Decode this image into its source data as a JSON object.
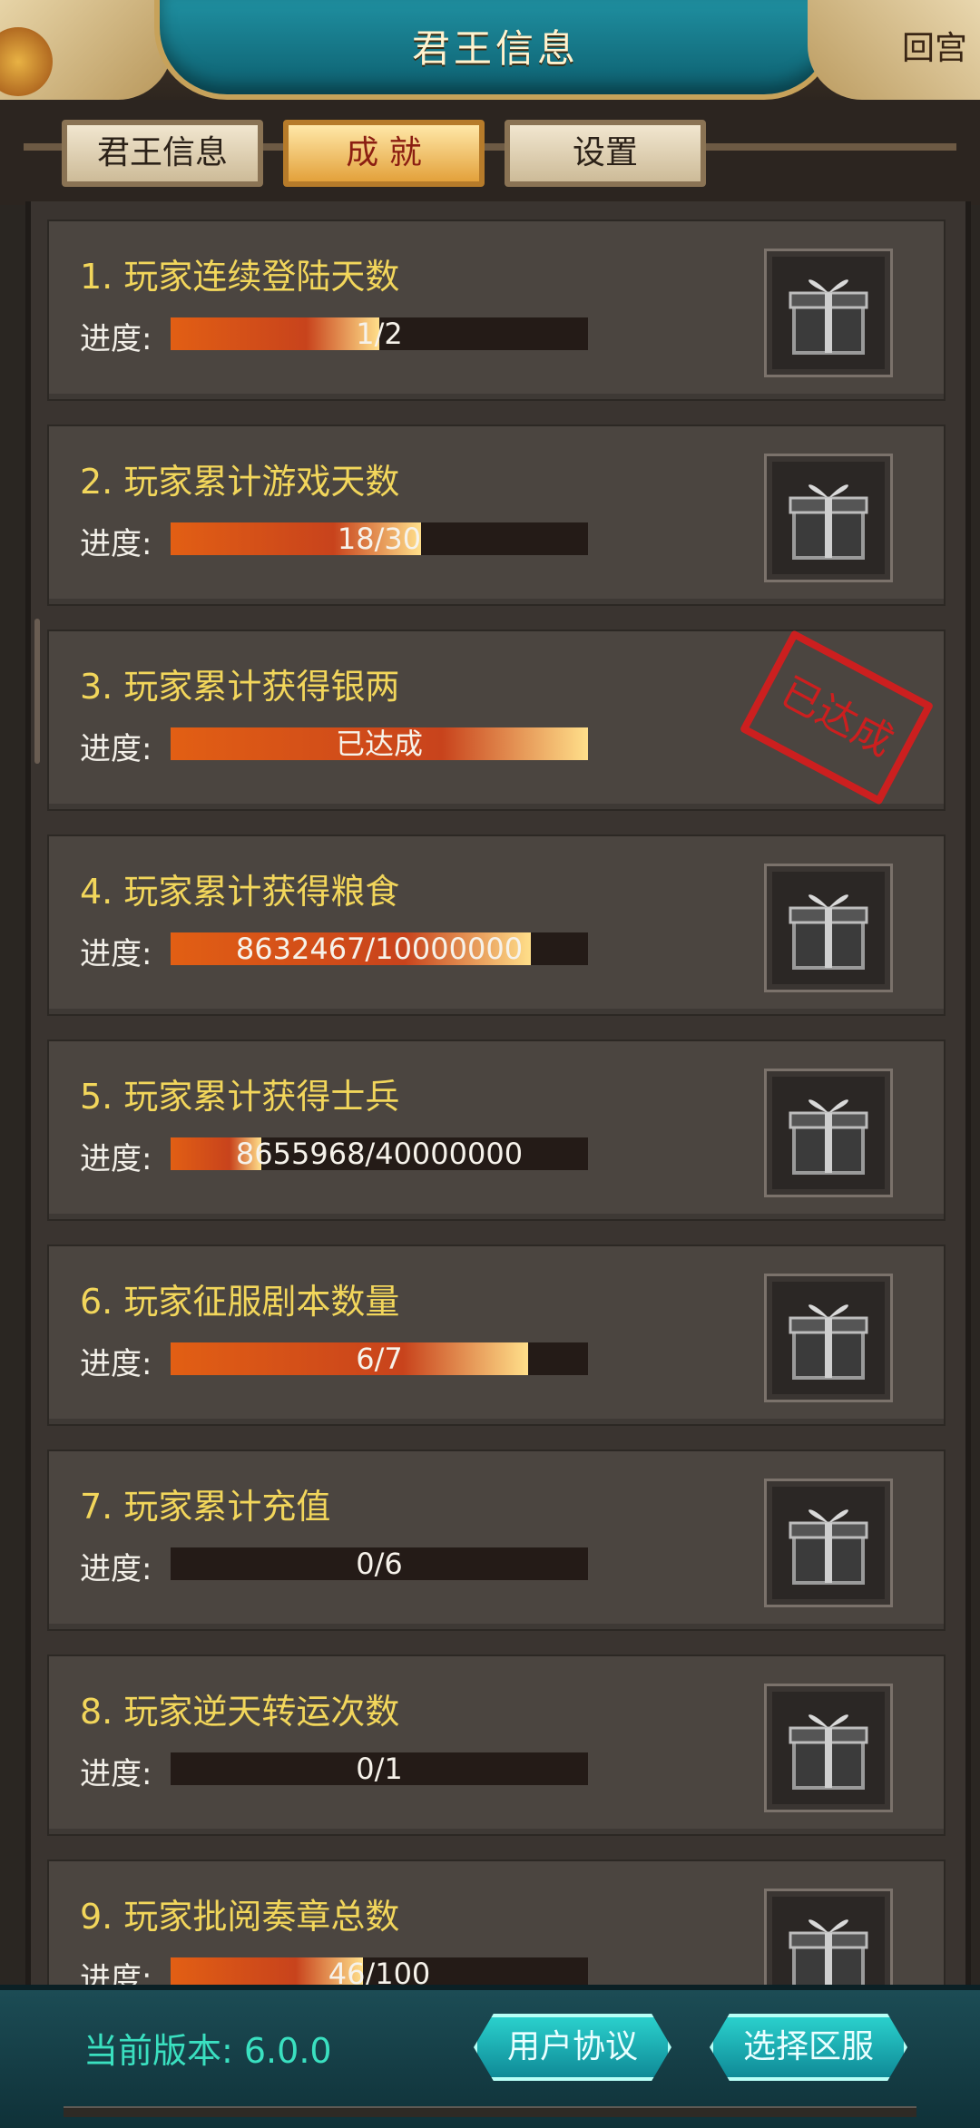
{
  "header": {
    "title": "君王信息",
    "back_label": "回宫"
  },
  "tabs": [
    {
      "label": "君王信息",
      "active": false
    },
    {
      "label": "成 就",
      "active": true
    },
    {
      "label": "设置",
      "active": false
    }
  ],
  "achievements": [
    {
      "title": "1. 玩家连续登陆天数",
      "progress_label": "进度:",
      "progress_text": "1/2",
      "progress_fraction": 0.5,
      "completed": false
    },
    {
      "title": "2. 玩家累计游戏天数",
      "progress_label": "进度:",
      "progress_text": "18/30",
      "progress_fraction": 0.6,
      "completed": false
    },
    {
      "title": "3. 玩家累计获得银两",
      "progress_label": "进度:",
      "progress_text": "已达成",
      "progress_fraction": 1.0,
      "completed": true,
      "stamp_text": "已达成"
    },
    {
      "title": "4. 玩家累计获得粮食",
      "progress_label": "进度:",
      "progress_text": "8632467/10000000",
      "progress_fraction": 0.8632,
      "completed": false
    },
    {
      "title": "5. 玩家累计获得士兵",
      "progress_label": "进度:",
      "progress_text": "8655968/40000000",
      "progress_fraction": 0.2164,
      "completed": false
    },
    {
      "title": "6. 玩家征服剧本数量",
      "progress_label": "进度:",
      "progress_text": "6/7",
      "progress_fraction": 0.857,
      "completed": false
    },
    {
      "title": "7. 玩家累计充值",
      "progress_label": "进度:",
      "progress_text": "0/6",
      "progress_fraction": 0.0,
      "completed": false
    },
    {
      "title": "8. 玩家逆天转运次数",
      "progress_label": "进度:",
      "progress_text": "0/1",
      "progress_fraction": 0.0,
      "completed": false
    },
    {
      "title": "9. 玩家批阅奏章总数",
      "progress_label": "进度:",
      "progress_text": "46/100",
      "progress_fraction": 0.46,
      "completed": false
    }
  ],
  "footer": {
    "version_label": "当前版本: 6.0.0",
    "agreement_label": "用户协议",
    "server_label": "选择区服"
  },
  "colors": {
    "title_yellow": "#f2d65b",
    "stamp_red": "#cc1f1f",
    "teal_accent": "#3ae0c0"
  },
  "icons": {
    "reward": "gift-box-icon",
    "back": "return-palace"
  }
}
